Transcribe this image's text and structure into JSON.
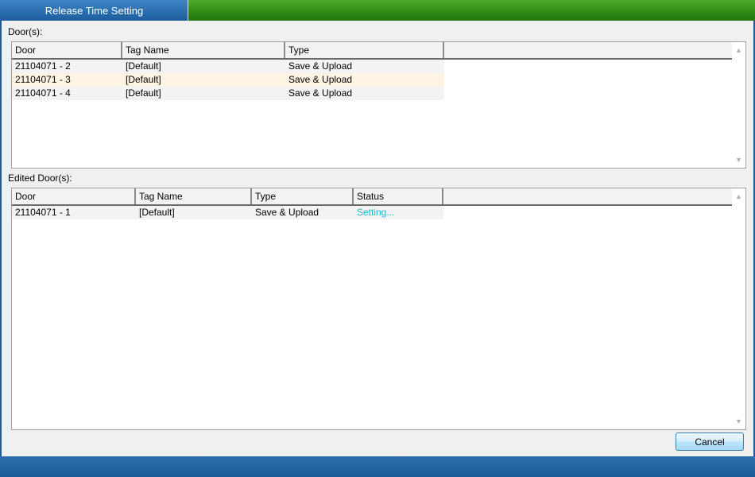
{
  "window": {
    "title": "Release Time Setting"
  },
  "doors": {
    "label": "Door(s):",
    "columns": [
      "Door",
      "Tag Name",
      "Type"
    ],
    "rows": [
      {
        "door": "21104071 - 2",
        "tag": "[Default]",
        "type": "Save & Upload"
      },
      {
        "door": "21104071 - 3",
        "tag": "[Default]",
        "type": "Save & Upload"
      },
      {
        "door": "21104071 - 4",
        "tag": "[Default]",
        "type": "Save & Upload"
      }
    ]
  },
  "edited": {
    "label": "Edited Door(s):",
    "columns": [
      "Door",
      "Tag Name",
      "Type",
      "Status"
    ],
    "rows": [
      {
        "door": "21104071 - 1",
        "tag": "[Default]",
        "type": "Save & Upload",
        "status": "Setting..."
      }
    ]
  },
  "buttons": {
    "cancel": "Cancel"
  },
  "icons": {
    "scroll_up": "chevron-up-icon",
    "scroll_down": "chevron-down-icon"
  },
  "colors": {
    "title_tab": "#2a6fb0",
    "title_bar": "#2e8a14",
    "status_setting": "#1fb7c9",
    "row_highlight": "#fdf3e2"
  }
}
